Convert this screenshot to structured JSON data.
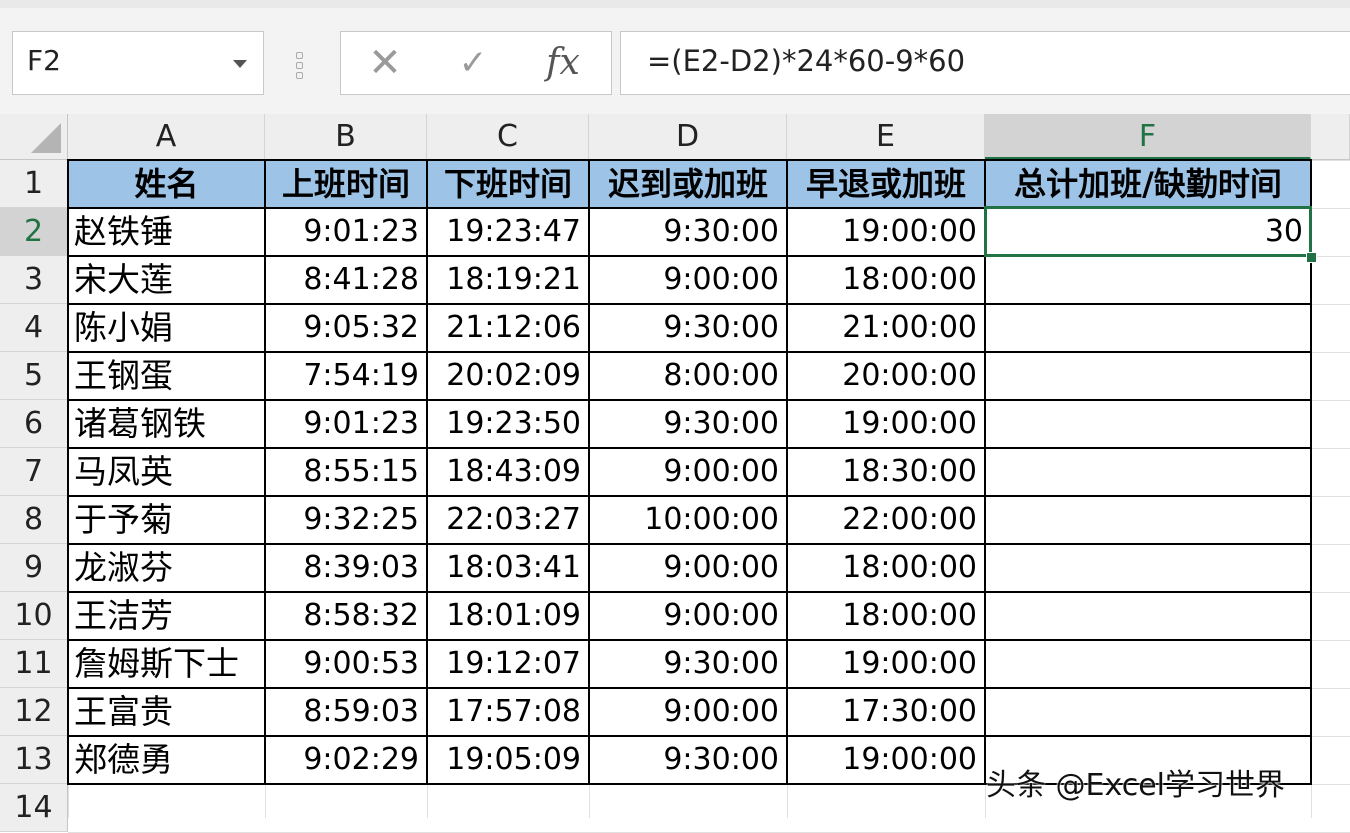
{
  "namebox": {
    "value": "F2"
  },
  "formula_bar": {
    "cancel_icon": "✕",
    "enter_icon": "✓",
    "fx_label": "fx",
    "formula": "=(E2-D2)*24*60-9*60"
  },
  "columns": [
    "A",
    "B",
    "C",
    "D",
    "E",
    "F"
  ],
  "selected_column": "F",
  "row_numbers": [
    "1",
    "2",
    "3",
    "4",
    "5",
    "6",
    "7",
    "8",
    "9",
    "10",
    "11",
    "12",
    "13",
    "14"
  ],
  "selected_row": "2",
  "header_row": [
    "姓名",
    "上班时间",
    "下班时间",
    "迟到或加班",
    "早退或加班",
    "总计加班/缺勤时间"
  ],
  "rows": [
    [
      "赵铁锤",
      "9:01:23",
      "19:23:47",
      "9:30:00",
      "19:00:00",
      "30"
    ],
    [
      "宋大莲",
      "8:41:28",
      "18:19:21",
      "9:00:00",
      "18:00:00",
      ""
    ],
    [
      "陈小娟",
      "9:05:32",
      "21:12:06",
      "9:30:00",
      "21:00:00",
      ""
    ],
    [
      "王钢蛋",
      "7:54:19",
      "20:02:09",
      "8:00:00",
      "20:00:00",
      ""
    ],
    [
      "诸葛钢铁",
      "9:01:23",
      "19:23:50",
      "9:30:00",
      "19:00:00",
      ""
    ],
    [
      "马凤英",
      "8:55:15",
      "18:43:09",
      "9:00:00",
      "18:30:00",
      ""
    ],
    [
      "于予菊",
      "9:32:25",
      "22:03:27",
      "10:00:00",
      "22:00:00",
      ""
    ],
    [
      "龙淑芬",
      "8:39:03",
      "18:03:41",
      "9:00:00",
      "18:00:00",
      ""
    ],
    [
      "王洁芳",
      "8:58:32",
      "18:01:09",
      "9:00:00",
      "18:00:00",
      ""
    ],
    [
      "詹姆斯下士",
      "9:00:53",
      "19:12:07",
      "9:30:00",
      "19:00:00",
      ""
    ],
    [
      "王富贵",
      "8:59:03",
      "17:57:08",
      "9:00:00",
      "17:30:00",
      ""
    ],
    [
      "郑德勇",
      "9:02:29",
      "19:05:09",
      "9:30:00",
      "19:00:00",
      ""
    ]
  ],
  "watermark": "头条 @Excel学习世界",
  "colors": {
    "header_fill": "#9dc3e6",
    "selection": "#217346"
  }
}
